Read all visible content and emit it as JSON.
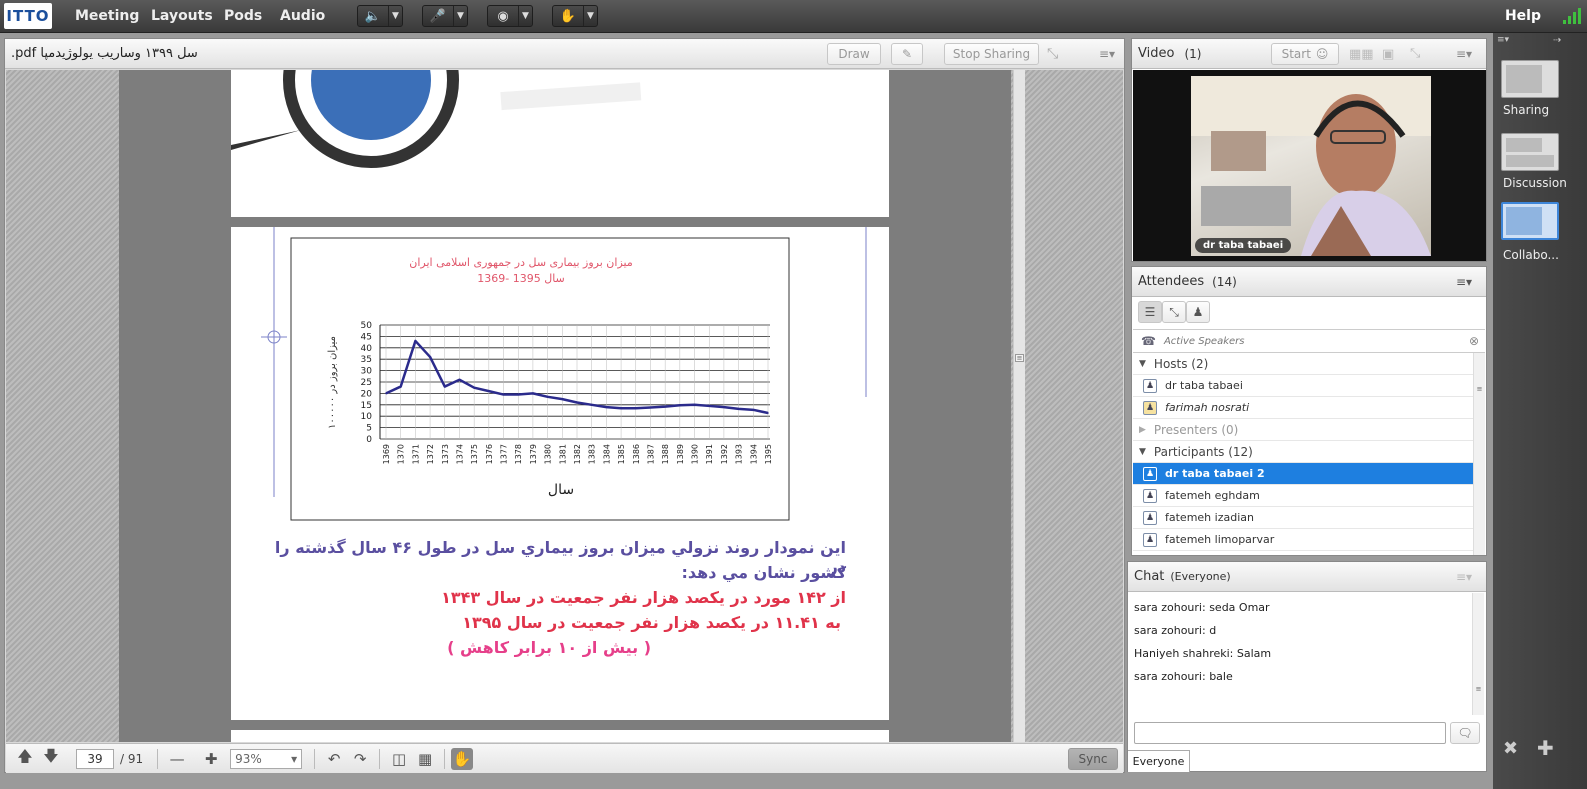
{
  "topbar": {
    "logo": "ITTO",
    "menus": [
      "Meeting",
      "Layouts",
      "Pods",
      "Audio"
    ],
    "help": "Help"
  },
  "share": {
    "title": ".pdf سل ۱۳۹۹ وساریب یولوژیدمپا",
    "draw": "Draw",
    "stop_sharing": "Stop Sharing",
    "footer": {
      "page": "39",
      "total": "/ 91",
      "zoom": "93%",
      "sync": "Sync"
    }
  },
  "chart_data": {
    "type": "line",
    "title": "میزان بروز بیماری سل در جمهوری اسلامی ایران",
    "subtitle": "سال 1395 -1369",
    "xlabel": "سال",
    "ylabel": "میزان بروز در ۱۰۰۰۰۰",
    "ylim": [
      0,
      50
    ],
    "yticks": [
      "0",
      "5",
      "10",
      "15",
      "20",
      "25",
      "30",
      "35",
      "40",
      "45",
      "50"
    ],
    "categories": [
      "1369",
      "1370",
      "1371",
      "1372",
      "1373",
      "1374",
      "1375",
      "1376",
      "1377",
      "1378",
      "1379",
      "1380",
      "1381",
      "1382",
      "1383",
      "1384",
      "1385",
      "1386",
      "1387",
      "1388",
      "1389",
      "1390",
      "1391",
      "1392",
      "1393",
      "1394",
      "1395"
    ],
    "values": [
      20,
      23,
      43,
      36,
      23,
      26,
      22.5,
      21,
      19.5,
      19.5,
      20,
      18.5,
      17.5,
      16,
      15,
      14,
      13.5,
      13.5,
      13.8,
      14.2,
      14.8,
      15,
      14.5,
      14,
      13.2,
      12.8,
      11.4
    ],
    "color": "#2b2b8c",
    "grid": true
  },
  "doc_text": {
    "line1": "اين نمودار روند نزولي ميزان بروز بيماري سل در طول ۴۶ سال گذشته را در",
    "line2": "كشور نشان مي دهد:",
    "line3": "از ۱۴۲ مورد در يكصد هزار نفر جمعيت در سال ۱۳۴۳",
    "line4": "به ۱۱.۴۱ در يكصد هزار نفر جمعيت در سال ۱۳۹۵",
    "line5": "( بيش از ۱۰ برابر كاهش )"
  },
  "video": {
    "title": "Video",
    "count": "(1)",
    "start": "Start",
    "name_label": "dr taba tabaei"
  },
  "attendees": {
    "title": "Attendees",
    "count": "(14)",
    "active_speakers": "Active Speakers",
    "hosts_label": "Hosts (2)",
    "hosts": [
      "dr taba tabaei",
      "farimah nosrati"
    ],
    "presenters_label": "Presenters (0)",
    "participants_label": "Participants (12)",
    "participants": [
      "dr taba tabaei 2",
      "fatemeh eghdam",
      "fatemeh izadian",
      "fatemeh limoparvar"
    ]
  },
  "chat": {
    "title": "Chat",
    "scope": "(Everyone)",
    "messages": [
      {
        "from": "sara zohouri:",
        "text": "seda Omar"
      },
      {
        "from": "sara zohouri:",
        "text": "d"
      },
      {
        "from": "Haniyeh shahreki:",
        "text": "Salam"
      },
      {
        "from": "sara zohouri:",
        "text": "bale"
      }
    ],
    "tab": "Everyone"
  },
  "layouts": {
    "items": [
      "Sharing",
      "Discussion",
      "Collabo..."
    ]
  },
  "colors": {
    "selected_row": "#1e7fe0",
    "doc_text_blue": "#5a4fa0",
    "doc_text_red": "#e0334a",
    "doc_text_pink": "#e63f8a",
    "chart_title": "#e0566a"
  }
}
